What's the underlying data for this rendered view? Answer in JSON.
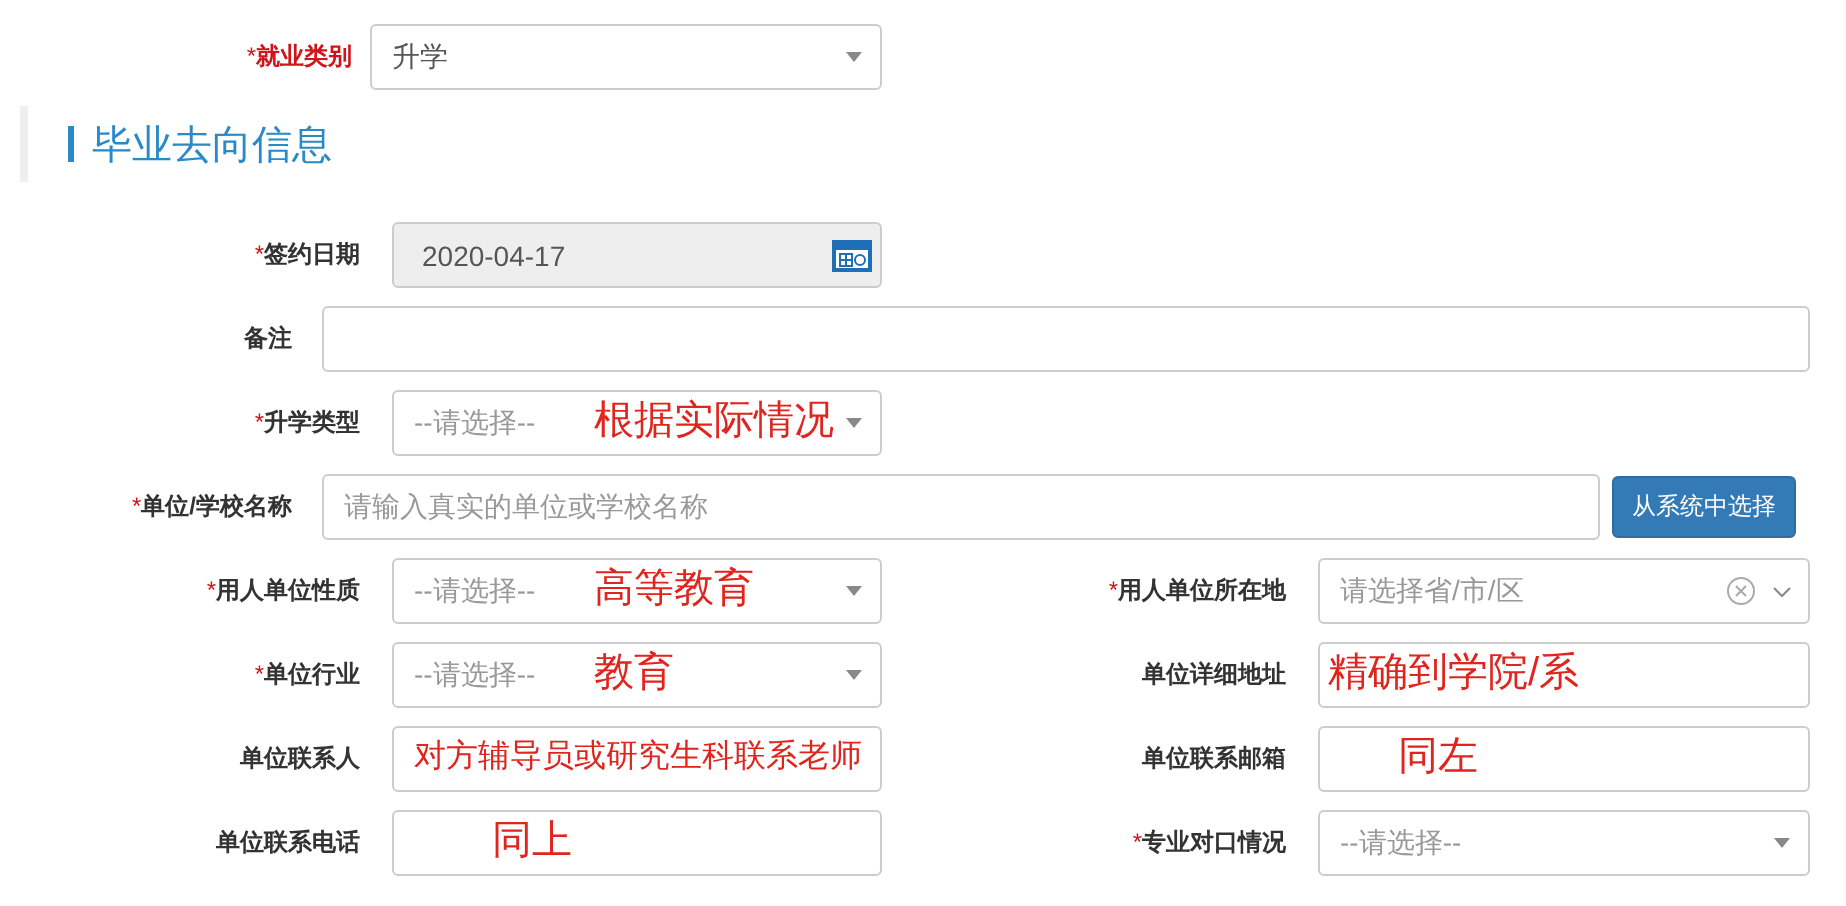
{
  "top_field": {
    "label": "就业类别",
    "required_mark": "*",
    "emphasized": true,
    "kind": "select",
    "value": "升学"
  },
  "section": {
    "title": "毕业去向信息"
  },
  "rows": [
    {
      "kind": "single",
      "left": {
        "label": "签约日期",
        "required_mark": "*",
        "kind": "date",
        "value": "2020-04-17",
        "disabled": true
      }
    },
    {
      "kind": "wide",
      "left": {
        "label": "备注",
        "kind": "input"
      }
    },
    {
      "kind": "single",
      "left": {
        "label": "升学类型",
        "required_mark": "*",
        "kind": "select",
        "placeholder": "--请选择--",
        "annotation": "根据实际情况"
      }
    },
    {
      "kind": "wide",
      "left": {
        "label": "单位/学校名称",
        "required_mark": "*",
        "kind": "input",
        "placeholder": "请输入真实的单位或学校名称"
      },
      "button": "从系统中选择"
    },
    {
      "kind": "pair",
      "left": {
        "label": "用人单位性质",
        "required_mark": "*",
        "kind": "select",
        "placeholder": "--请选择--",
        "annotation": "高等教育"
      },
      "right": {
        "label": "用人单位所在地",
        "required_mark": "*",
        "kind": "cascader",
        "placeholder": "请选择省/市/区"
      }
    },
    {
      "kind": "pair",
      "left": {
        "label": "单位行业",
        "required_mark": "*",
        "kind": "select",
        "placeholder": "--请选择--",
        "annotation": "教育"
      },
      "right": {
        "label": "单位详细地址",
        "kind": "input",
        "annotation": "精确到学院/系"
      }
    },
    {
      "kind": "pair",
      "left": {
        "label": "单位联系人",
        "kind": "input",
        "annotation": "对方辅导员或研究生科联系老师"
      },
      "right": {
        "label": "单位联系邮箱",
        "kind": "input",
        "annotation": "同左"
      }
    },
    {
      "kind": "pair",
      "left": {
        "label": "单位联系电话",
        "kind": "input",
        "annotation": "同上"
      },
      "right": {
        "label": "专业对口情况",
        "required_mark": "*",
        "kind": "select",
        "placeholder": "--请选择--"
      }
    }
  ]
}
